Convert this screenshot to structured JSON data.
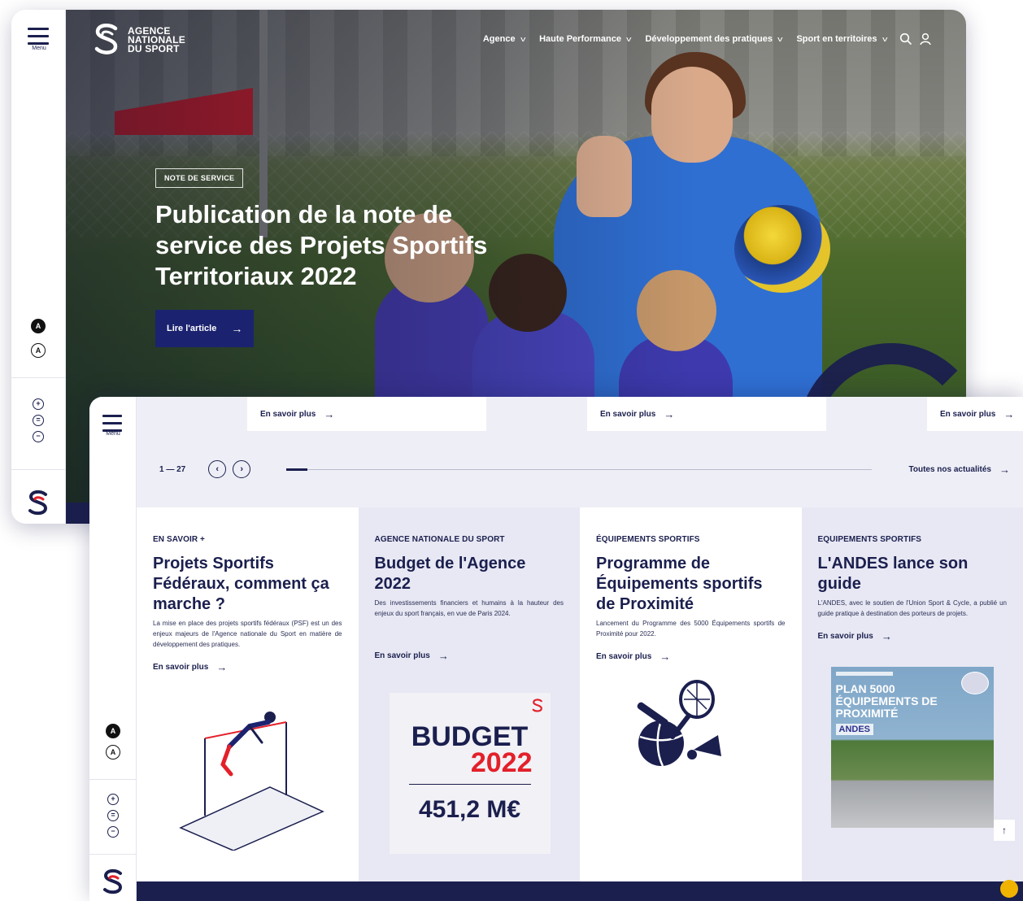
{
  "window1": {
    "rail": {
      "menu_label": "Menu",
      "contrast": [
        "A",
        "A"
      ],
      "zoom": [
        "+",
        "=",
        "−"
      ]
    },
    "brand": {
      "line1": "AGENCE",
      "line2": "NATIONALE",
      "line3": "DU SPORT"
    },
    "nav": [
      {
        "label": "Agence"
      },
      {
        "label": "Haute Performance"
      },
      {
        "label": "Développement des pratiques"
      },
      {
        "label": "Sport en territoires"
      }
    ],
    "nav_icons": [
      "search-icon",
      "user-icon"
    ],
    "hero": {
      "tag": "NOTE DE SERVICE",
      "title": "Publication de la note de service des Projets Sportifs Territoriaux 2022",
      "cta": "Lire l'article",
      "cta_arrow": "→"
    }
  },
  "window2": {
    "rail": {
      "menu_label": "Menu",
      "contrast": [
        "A",
        "A"
      ],
      "zoom": [
        "+",
        "=",
        "−"
      ]
    },
    "prev_cards": [
      {
        "more": "En savoir plus"
      },
      {
        "more": "En savoir plus"
      },
      {
        "more": "En savoir plus"
      }
    ],
    "pager": {
      "range": "1 — 27",
      "prev": "‹",
      "next": "›",
      "all_news": "Toutes nos actualités"
    },
    "cards": [
      {
        "category": "EN SAVOIR +",
        "title": "Projets Sportifs Fédéraux, comment ça marche ?",
        "description": "La mise en place des projets sportifs fédéraux (PSF) est un des enjeux majeurs de l'Agence nationale du Sport en matière de développement des pratiques.",
        "more": "En savoir plus"
      },
      {
        "category": "AGENCE NATIONALE DU SPORT",
        "title": "Budget de l'Agence 2022",
        "description": "Des investissements financiers et humains à la hauteur des enjeux du sport français, en vue de Paris 2024.",
        "more": "En savoir plus",
        "visual": {
          "word": "BUDGET",
          "year": "2022",
          "amount": "451,2 M€"
        }
      },
      {
        "category": "ÉQUIPEMENTS SPORTIFS",
        "title": "Programme de Équipements sportifs de Proximité",
        "description": "Lancement du Programme des 5000 Équipements sportifs de Proximité pour 2022.",
        "more": "En savoir plus"
      },
      {
        "category": "EQUIPEMENTS SPORTIFS",
        "title": "L'ANDES lance son guide",
        "description": "L'ANDES, avec le soutien de l'Union Sport & Cycle, a publié un guide pratique à destination des porteurs de projets.",
        "more": "En savoir plus",
        "visual": {
          "headline": "PLAN 5000 ÉQUIPEMENTS DE PROXIMITÉ",
          "brand": "ANDES"
        }
      }
    ]
  },
  "colors": {
    "navy": "#1b1f4e",
    "cta": "#1b2370",
    "red": "#e3202a",
    "panel": "#eeeff6"
  }
}
